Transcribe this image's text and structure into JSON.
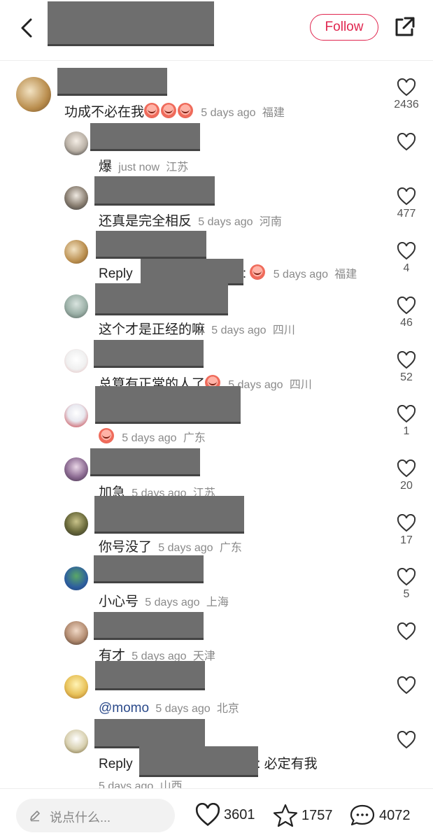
{
  "header": {
    "follow_label": "Follow"
  },
  "comments": [
    {
      "text": "功成不必在我",
      "emoji_count": 3,
      "time": "5 days ago",
      "location": "福建",
      "likes": "2436"
    },
    {
      "text": "爆",
      "time": "just now",
      "location": "江苏",
      "likes": ""
    },
    {
      "text": "还真是完全相反",
      "time": "5 days ago",
      "location": "河南",
      "likes": "477"
    },
    {
      "prefix": "Reply",
      "suffix": ":",
      "time": "5 days ago",
      "location": "福建",
      "likes": "4"
    },
    {
      "text": "这个才是正经的嘛",
      "time": "5 days ago",
      "location": "四川",
      "likes": "46"
    },
    {
      "text": "总算有正常的人了",
      "time": "5 days ago",
      "location": "四川",
      "likes": "52"
    },
    {
      "text": "",
      "time": "5 days ago",
      "location": "广东",
      "likes": "1"
    },
    {
      "text": "加急",
      "time": "5 days ago",
      "location": "江苏",
      "likes": "20"
    },
    {
      "text": "你号没了",
      "time": "5 days ago",
      "location": "广东",
      "likes": "17"
    },
    {
      "text": "小心号",
      "time": "5 days ago",
      "location": "上海",
      "likes": "5"
    },
    {
      "text": "有才",
      "time": "5 days ago",
      "location": "天津",
      "likes": ""
    },
    {
      "text": "@momo",
      "time": "5 days ago",
      "location": "北京",
      "likes": ""
    },
    {
      "prefix": "Reply",
      "suffix": "i: 必定有我",
      "time": "5 days ago",
      "location": "山西",
      "likes": ""
    }
  ],
  "bottom_bar": {
    "placeholder": "说点什么...",
    "likes": "3601",
    "favorites": "1757",
    "comments": "4072"
  }
}
